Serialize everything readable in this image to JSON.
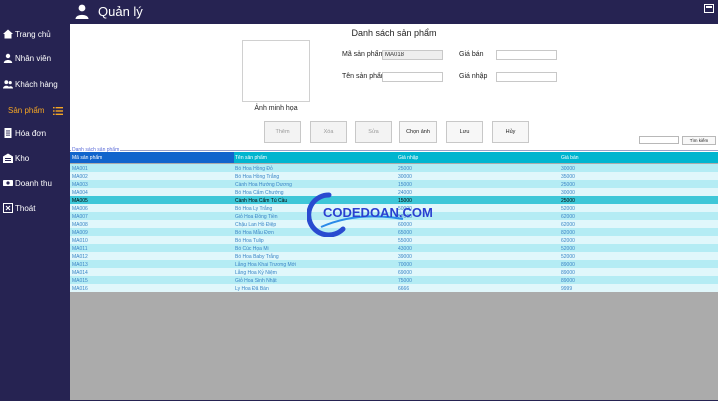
{
  "header": {
    "title": "Quản lý"
  },
  "sidebar": {
    "items": [
      {
        "label": "Trang chủ",
        "icon": "home-icon"
      },
      {
        "label": "Nhân viên",
        "icon": "user-icon"
      },
      {
        "label": "Khách hàng",
        "icon": "users-icon"
      },
      {
        "label": "Sản phẩm",
        "icon": "menu-icon",
        "active": true
      },
      {
        "label": "Hóa đơn",
        "icon": "receipt-icon"
      },
      {
        "label": "Kho",
        "icon": "warehouse-icon"
      },
      {
        "label": "Doanh thu",
        "icon": "money-icon"
      },
      {
        "label": "Thoát",
        "icon": "exit-icon"
      }
    ]
  },
  "form": {
    "title": "Danh sách sản phẩm",
    "image_label": "Ảnh minh họa",
    "code_label": "Mã sản phẩm",
    "code_value": "MA018",
    "name_label": "Tên sản phẩm",
    "name_value": "",
    "price_label": "Giá bán",
    "price_value": "",
    "import_label": "Giá nhập",
    "import_value": ""
  },
  "buttons": {
    "add": "Thêm",
    "delete": "Xóa",
    "edit": "Sửa",
    "choose_image": "Chọn ảnh",
    "save": "Lưu",
    "cancel": "Hủy",
    "search": "Tìm kiếm"
  },
  "table": {
    "group_title": "Danh sách sản phẩm",
    "columns": [
      "Mã sản phẩm",
      "Tên sản phẩm",
      "Giá nhập",
      "Giá bán"
    ],
    "selected_index": 4,
    "rows": [
      [
        "MA001",
        "Bó Hoa Hồng Đỏ",
        "25000",
        "30000"
      ],
      [
        "MA002",
        "Bó Hoa Hồng Trắng",
        "30000",
        "35000"
      ],
      [
        "MA003",
        "Cành Hoa Hướng Dương",
        "15000",
        "25000"
      ],
      [
        "MA004",
        "Bó Hoa Cẩm Chướng",
        "24000",
        "30000"
      ],
      [
        "MA005",
        "Cành Hoa Cẩm Tú Cầu",
        "15000",
        "25000"
      ],
      [
        "MA006",
        "Bó Hoa Ly Trắng",
        "50000",
        "52000"
      ],
      [
        "MA007",
        "Giỏ Hoa Đồng Tiền",
        "52000",
        "62000"
      ],
      [
        "MA008",
        "Chậu Lan Hồ Điệp",
        "60000",
        "62000"
      ],
      [
        "MA009",
        "Bó Hoa Mẫu Đơn",
        "65000",
        "82000"
      ],
      [
        "MA010",
        "Bó Hoa Tulip",
        "55000",
        "62000"
      ],
      [
        "MA011",
        "Bó Cúc Họa Mi",
        "43000",
        "52000"
      ],
      [
        "MA012",
        "Bó Hoa Baby Trắng",
        "39000",
        "52000"
      ],
      [
        "MA013",
        "Lẵng Hoa Khai Trương Mới",
        "70000",
        "89000"
      ],
      [
        "MA014",
        "Lẵng Hoa Kỷ Niệm",
        "69000",
        "89000"
      ],
      [
        "MA015",
        "Giỏ Hoa Sinh Nhật",
        "75000",
        "89000"
      ],
      [
        "MA016",
        "Ly Hoa Đã Bán",
        "6666",
        "9999"
      ]
    ]
  },
  "watermark": {
    "text": "CODEDOAN.COM"
  },
  "colors": {
    "sidebar_bg": "#262352",
    "active_nav": "#f5a623",
    "header_primary": "#1164cc",
    "header_secondary": "#00b5cf",
    "row_odd": "#b4ecf4",
    "row_even": "#e0f7fb",
    "row_selected": "#3ec7d8",
    "grid_bg": "#ababab"
  }
}
